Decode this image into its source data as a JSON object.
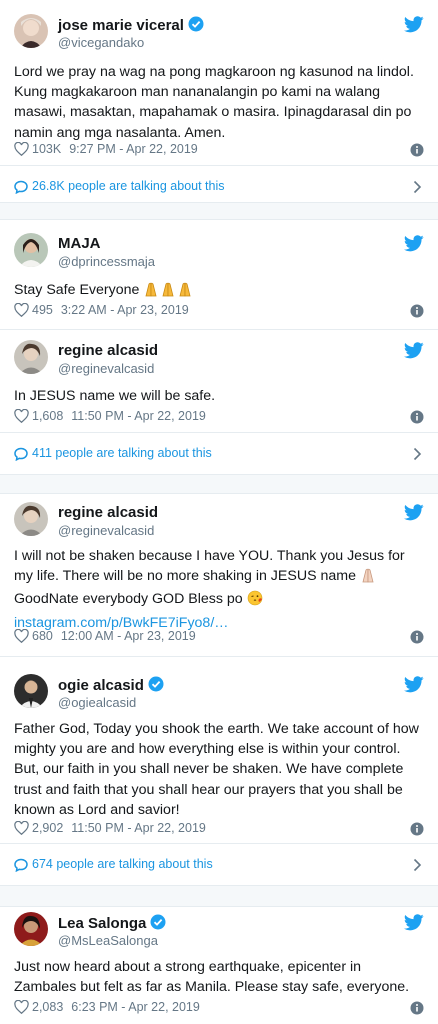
{
  "tweets": [
    {
      "name": "jose marie viceral",
      "handle": "@vicegandako",
      "verified": true,
      "text": "Lord we pray na wag na pong magkaroon ng kasunod na lindol. Kung magkakaroon man nananalangin po kami na walang masawi, masaktan, mapahamak o masira. Ipinagdarasal din po namin ang mga nasalanta. Amen.",
      "likes": "103K",
      "time": "9:27 PM - Apr 22, 2019",
      "talking": "26.8K people are talking about this"
    },
    {
      "name": "MAJA",
      "handle": "@dprincessmaja",
      "verified": false,
      "text": "Stay Safe Everyone",
      "likes": "495",
      "time": "3:22 AM - Apr 23, 2019"
    },
    {
      "name": "regine alcasid",
      "handle": "@reginevalcasid",
      "verified": false,
      "text": "In JESUS name we will be safe.",
      "likes": "1,608",
      "time": "11:50 PM - Apr 22, 2019",
      "talking": "411 people are talking about this"
    },
    {
      "name": "regine alcasid",
      "handle": "@reginevalcasid",
      "verified": false,
      "text_1": "I will not be shaken because I have YOU. Thank you Jesus for my life. There will be no more shaking in JESUS name",
      "text_2": "GoodNate everybody GOD Bless po",
      "link": "instagram.com/p/BwkFE7iFyo8/…",
      "likes": "680",
      "time": "12:00 AM - Apr 23, 2019"
    },
    {
      "name": "ogie alcasid",
      "handle": "@ogiealcasid",
      "verified": true,
      "text": "Father God, Today you shook the earth. We take account of how mighty you are and how everything else is within your control. But, our faith in you shall never be shaken. We have complete trust and faith that you shall hear our prayers that you shall be known as Lord and savior!",
      "likes": "2,902",
      "time": "11:50 PM - Apr 22, 2019",
      "talking": "674 people are talking about this"
    },
    {
      "name": "Lea Salonga",
      "handle": "@MsLeaSalonga",
      "verified": true,
      "text": "Just now heard about a strong earthquake, epicenter in Zambales but felt as far as Manila. Please stay safe, everyone.",
      "likes": "2,083",
      "time": "6:23 PM - Apr 22, 2019"
    }
  ],
  "colors": {
    "twitter_blue": "#1da1f2",
    "link_blue": "#1b95e0",
    "muted": "#657786",
    "text": "#14171a",
    "divider": "#e6ecf0"
  },
  "icons": {
    "brand": "twitter-bird-icon",
    "verified": "verified-badge-icon",
    "like": "heart-icon",
    "info": "info-icon",
    "conversation": "speech-bubble-icon",
    "more": "chevron-right-icon"
  }
}
